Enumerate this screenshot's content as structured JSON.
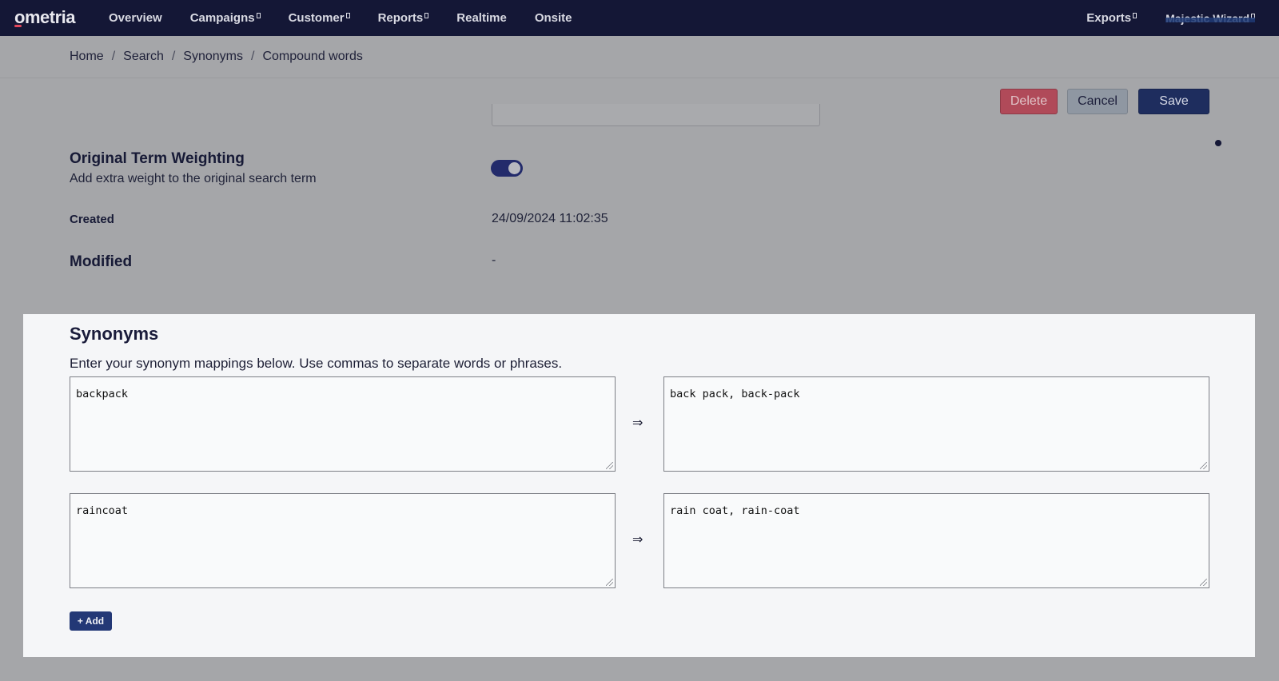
{
  "nav": {
    "logo": "ometria",
    "items": [
      {
        "label": "Overview",
        "dropdown": false
      },
      {
        "label": "Campaigns",
        "dropdown": true
      },
      {
        "label": "Customer",
        "dropdown": true
      },
      {
        "label": "Reports",
        "dropdown": true
      },
      {
        "label": "Realtime",
        "dropdown": false
      },
      {
        "label": "Onsite",
        "dropdown": false
      }
    ],
    "exports": "Exports",
    "user": "Majestic Wizard"
  },
  "breadcrumb": [
    "Home",
    "Search",
    "Synonyms",
    "Compound words"
  ],
  "actions": {
    "delete": "Delete",
    "cancel": "Cancel",
    "save": "Save"
  },
  "details": {
    "weighting_title": "Original Term Weighting",
    "weighting_desc": "Add extra weight to the original search term",
    "weighting_enabled": true,
    "created_label": "Created",
    "created_value": "24/09/2024 11:02:35",
    "modified_label": "Modified",
    "modified_value": "-"
  },
  "synonyms": {
    "title": "Synonyms",
    "description": "Enter your synonym mappings below. Use commas to separate words or phrases.",
    "arrow": "⇒",
    "rows": [
      {
        "term": "backpack",
        "synonyms": "back pack, back-pack"
      },
      {
        "term": "raincoat",
        "synonyms": "rain coat, rain-coat"
      }
    ],
    "add_label": "+ Add"
  },
  "colors": {
    "nav_bg": "#141736",
    "save": "#1e2d5e",
    "delete": "#b04a59",
    "toggle_on": "#232b6b"
  }
}
